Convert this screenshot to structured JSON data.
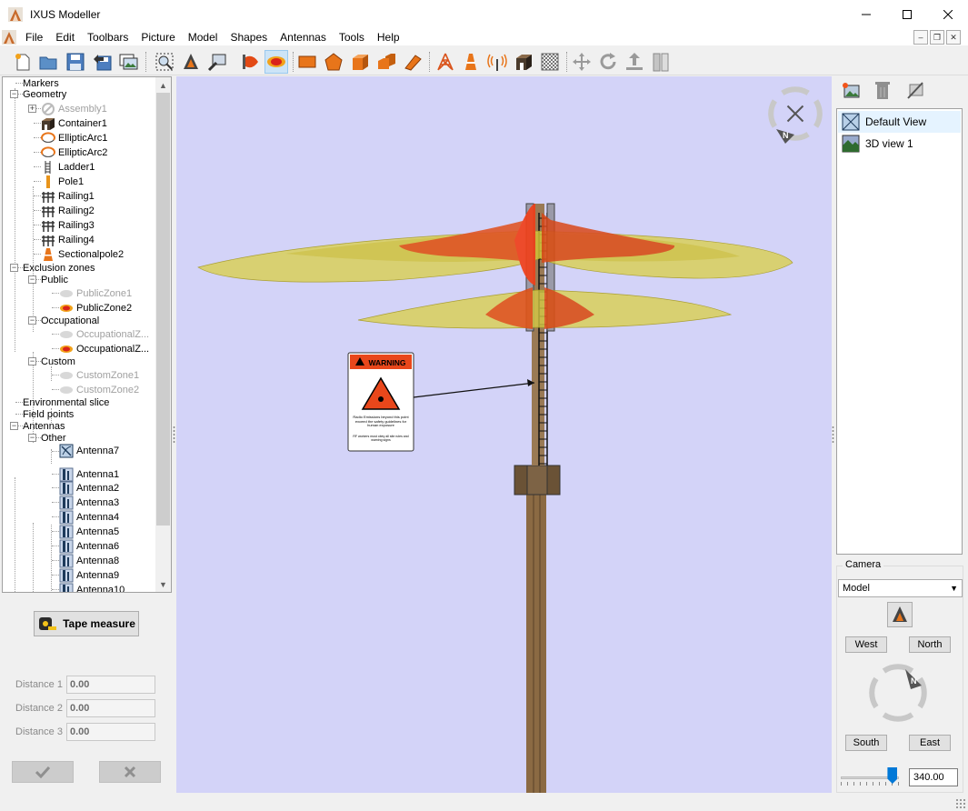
{
  "window": {
    "title": "IXUS Modeller",
    "controls": [
      "minimize",
      "maximize",
      "close"
    ]
  },
  "menu": [
    "File",
    "Edit",
    "Toolbars",
    "Picture",
    "Model",
    "Shapes",
    "Antennas",
    "Tools",
    "Help"
  ],
  "toolbar": {
    "icons": [
      "new-file-icon",
      "open-folder-icon",
      "save-icon",
      "save-as-icon",
      "export-images-icon",
      "zoom-select-icon",
      "camera-view-icon",
      "render-options-icon",
      "zone-color-icon",
      "exclusion-zone-icon",
      "rectangle-shape-icon",
      "polygon-shape-icon",
      "box-shape-icon",
      "extrude-shape-icon",
      "slab-shape-icon",
      "tower-icon",
      "sectional-pole-icon",
      "antenna-icon",
      "container-icon",
      "texture-icon",
      "move-icon",
      "rotate-icon",
      "lift-icon",
      "panel-icon"
    ],
    "active": "exclusion-zone-icon"
  },
  "tree": {
    "nodes": [
      {
        "label": "Markers",
        "level": 0,
        "expander": "",
        "icon": "",
        "dim": false
      },
      {
        "label": "Geometry",
        "level": 0,
        "expander": "−",
        "icon": "",
        "dim": false
      },
      {
        "label": "Assembly1",
        "level": 1,
        "expander": "+",
        "icon": "assembly-icon",
        "dim": true
      },
      {
        "label": "Container1",
        "level": 1,
        "expander": "",
        "icon": "container-icon",
        "dim": false
      },
      {
        "label": "EllipticArc1",
        "level": 1,
        "expander": "",
        "icon": "elliptic-arc-icon",
        "dim": false
      },
      {
        "label": "EllipticArc2",
        "level": 1,
        "expander": "",
        "icon": "elliptic-arc-icon",
        "dim": false
      },
      {
        "label": "Ladder1",
        "level": 1,
        "expander": "",
        "icon": "ladder-icon",
        "dim": false
      },
      {
        "label": "Pole1",
        "level": 1,
        "expander": "",
        "icon": "pole-icon",
        "dim": false
      },
      {
        "label": "Railing1",
        "level": 1,
        "expander": "",
        "icon": "railing-icon",
        "dim": false
      },
      {
        "label": "Railing2",
        "level": 1,
        "expander": "",
        "icon": "railing-icon",
        "dim": false
      },
      {
        "label": "Railing3",
        "level": 1,
        "expander": "",
        "icon": "railing-icon",
        "dim": false
      },
      {
        "label": "Railing4",
        "level": 1,
        "expander": "",
        "icon": "railing-icon",
        "dim": false
      },
      {
        "label": "Sectionalpole2",
        "level": 1,
        "expander": "",
        "icon": "sectional-pole-icon",
        "dim": false
      },
      {
        "label": "Exclusion zones",
        "level": 0,
        "expander": "−",
        "icon": "",
        "dim": false
      },
      {
        "label": "Public",
        "level": 1,
        "expander": "−",
        "icon": "",
        "dim": false
      },
      {
        "label": "PublicZone1",
        "level": 2,
        "expander": "",
        "icon": "zone-off-icon",
        "dim": true
      },
      {
        "label": "PublicZone2",
        "level": 2,
        "expander": "",
        "icon": "zone-on-icon",
        "dim": false
      },
      {
        "label": "Occupational",
        "level": 1,
        "expander": "−",
        "icon": "",
        "dim": false
      },
      {
        "label": "OccupationalZ...",
        "level": 2,
        "expander": "",
        "icon": "zone-off-icon",
        "dim": true
      },
      {
        "label": "OccupationalZ...",
        "level": 2,
        "expander": "",
        "icon": "zone-on-icon",
        "dim": false
      },
      {
        "label": "Custom",
        "level": 1,
        "expander": "−",
        "icon": "",
        "dim": false
      },
      {
        "label": "CustomZone1",
        "level": 2,
        "expander": "",
        "icon": "zone-off-icon",
        "dim": true
      },
      {
        "label": "CustomZone2",
        "level": 2,
        "expander": "",
        "icon": "zone-off-icon",
        "dim": true
      },
      {
        "label": "Environmental slice",
        "level": 0,
        "expander": "",
        "icon": "",
        "dim": false
      },
      {
        "label": "Field points",
        "level": 0,
        "expander": "",
        "icon": "",
        "dim": false
      },
      {
        "label": "Antennas",
        "level": 0,
        "expander": "−",
        "icon": "",
        "dim": false
      },
      {
        "label": "Other",
        "level": 1,
        "expander": "−",
        "icon": "",
        "dim": false
      },
      {
        "label": "Antenna7",
        "level": 2,
        "expander": "",
        "icon": "dish-antenna-icon",
        "dim": false
      },
      {
        "label": "Antenna1",
        "level": 2,
        "expander": "",
        "icon": "panel-antenna-icon",
        "dim": false
      },
      {
        "label": "Antenna2",
        "level": 2,
        "expander": "",
        "icon": "panel-antenna-icon",
        "dim": false
      },
      {
        "label": "Antenna3",
        "level": 2,
        "expander": "",
        "icon": "panel-antenna-icon",
        "dim": false
      },
      {
        "label": "Antenna4",
        "level": 2,
        "expander": "",
        "icon": "panel-antenna-icon",
        "dim": false
      },
      {
        "label": "Antenna5",
        "level": 2,
        "expander": "",
        "icon": "panel-antenna-icon",
        "dim": false
      },
      {
        "label": "Antenna6",
        "level": 2,
        "expander": "",
        "icon": "panel-antenna-icon",
        "dim": false
      },
      {
        "label": "Antenna8",
        "level": 2,
        "expander": "",
        "icon": "panel-antenna-icon",
        "dim": false
      },
      {
        "label": "Antenna9",
        "level": 2,
        "expander": "",
        "icon": "panel-antenna-icon",
        "dim": false
      },
      {
        "label": "Antenna10",
        "level": 2,
        "expander": "",
        "icon": "panel-antenna-icon",
        "dim": false
      }
    ]
  },
  "tape": {
    "button_label": "Tape measure",
    "distances": [
      {
        "label": "Distance 1",
        "value": "0.00"
      },
      {
        "label": "Distance 2",
        "value": "0.00"
      },
      {
        "label": "Distance 3",
        "value": "0.00"
      }
    ],
    "confirm_icon": "checkmark-icon",
    "cancel_icon": "cross-icon"
  },
  "viewport": {
    "background": "#d3d3f8",
    "warning_sign": {
      "header": "WARNING",
      "text": "Radio Emissions beyond this point exceed the safety guidelines for human exposure",
      "subtext": "RF workers must obey all site rules and warning signs"
    },
    "compass_letter": "N"
  },
  "views": {
    "items": [
      {
        "label": "Default View",
        "icon": "default-view-icon",
        "selected": true
      },
      {
        "label": "3D view 1",
        "icon": "landscape-view-icon",
        "selected": false
      }
    ],
    "tool_icons": [
      "new-view-icon",
      "trash-icon",
      "edit-view-icon"
    ]
  },
  "camera": {
    "group_label": "Camera",
    "mode": "Model",
    "buttons": {
      "west": "West",
      "north": "North",
      "south": "South",
      "east": "East"
    },
    "compass_letter": "N",
    "zoom_value": "340.00",
    "zoom_slider_fraction": 0.97
  }
}
